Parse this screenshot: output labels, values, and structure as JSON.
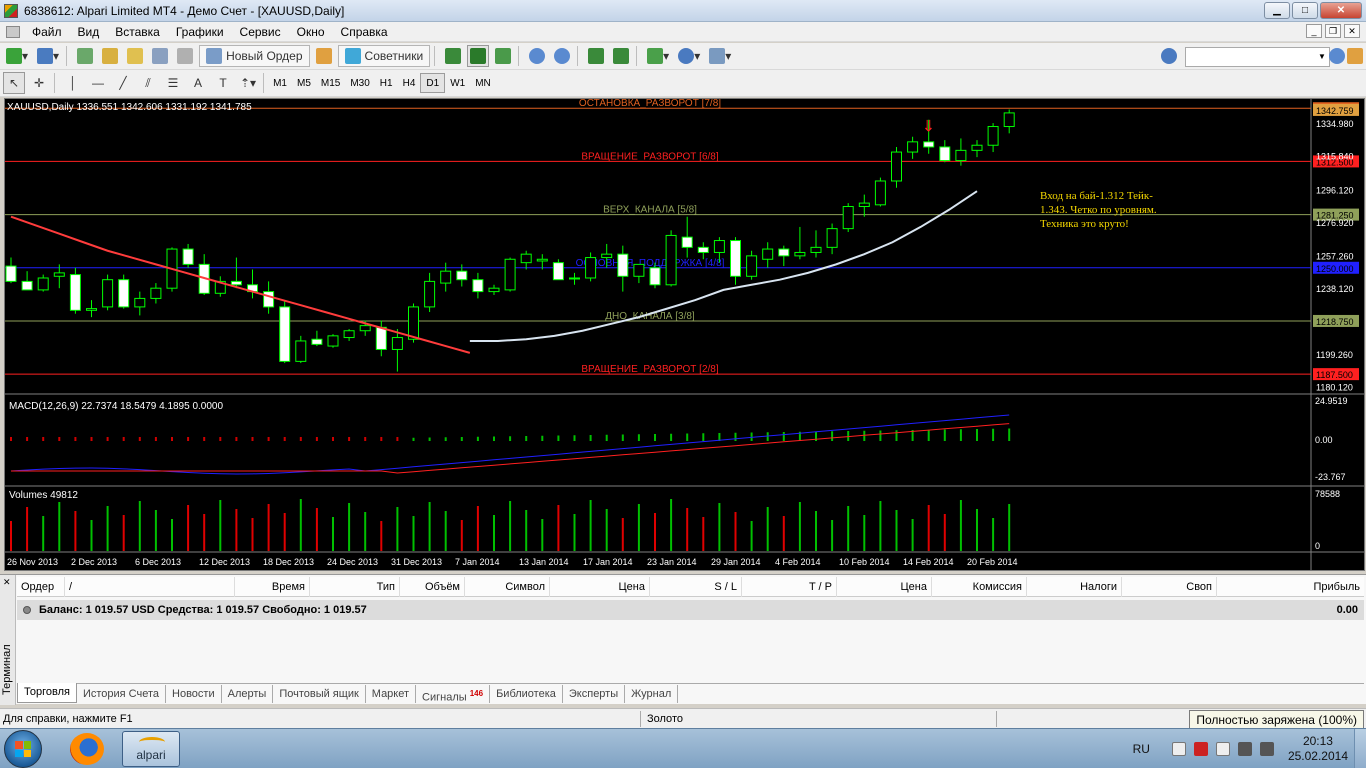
{
  "window": {
    "title": "6838612: Alpari Limited MT4 - Демо Счет - [XAUUSD,Daily]",
    "min": "▁",
    "max": "□",
    "close": "✕"
  },
  "menu": [
    "Файл",
    "Вид",
    "Вставка",
    "Графики",
    "Сервис",
    "Окно",
    "Справка"
  ],
  "toolbar": {
    "new_order": "Новый Ордер",
    "experts": "Советники",
    "timeframes": [
      "M1",
      "M5",
      "M15",
      "M30",
      "H1",
      "H4",
      "D1",
      "W1",
      "MN"
    ],
    "selected_timeframe": "D1"
  },
  "chart": {
    "header": "XAUUSD,Daily  1336.551 1342.606 1331.192 1341.785",
    "macd_label": "MACD(12,26,9) 22.7374 18.5479 4.1895 0.0000",
    "volumes_label": "Volumes 49812",
    "annotation_lines": [
      "Вход на бай-1.312 Тейк-",
      "1.343. Четко по уровням.",
      "Техника это круто!"
    ],
    "colors": {
      "bull": "#00ff00",
      "bull_fill": "#000000",
      "bear_fill": "#ffffff",
      "ma_red": "#ff3c3c",
      "ma_light": "#d8e4f0",
      "macd_main": "#2020ff",
      "macd_signal": "#ff2020"
    }
  },
  "chart_data": {
    "type": "candlestick",
    "symbol": "XAUUSD",
    "timeframe": "Daily",
    "price_axis_ticks": [
      "1342.759",
      "1334.980",
      "1315.840",
      "1312.500",
      "1296.120",
      "1281.250",
      "1276.920",
      "1257.260",
      "1250.000",
      "1238.120",
      "1218.750",
      "1199.260",
      "1187.500",
      "1180.120"
    ],
    "date_ticks": [
      "26 Nov 2013",
      "2 Dec 2013",
      "6 Dec 2013",
      "12 Dec 2013",
      "18 Dec 2013",
      "24 Dec 2013",
      "31 Dec 2013",
      "7 Jan 2014",
      "13 Jan 2014",
      "17 Jan 2014",
      "23 Jan 2014",
      "29 Jan 2014",
      "4 Feb 2014",
      "10 Feb 2014",
      "14 Feb 2014",
      "20 Feb 2014"
    ],
    "levels": [
      {
        "label": "ОСТАНОВКА_РАЗВОРОТ [7/8]",
        "price": 1343.75,
        "price_label": "1343.750",
        "color": "#e06020"
      },
      {
        "label": "ВРАЩЕНИЕ_РАЗВОРОТ [6/8]",
        "price": 1312.5,
        "price_label": "1312.500",
        "color": "#ff2020"
      },
      {
        "label": "ВЕРХ_КАНАЛА [5/8]",
        "price": 1281.25,
        "price_label": "1281.250",
        "color": "#8fa05a"
      },
      {
        "label": "ОСНОВНАЯ_ПОДДЕРЖКА [4/8]",
        "price": 1250.0,
        "price_label": "1250.000",
        "color": "#2020ff"
      },
      {
        "label": "ДНО_КАНАЛА [3/8]",
        "price": 1218.75,
        "price_label": "1218.750",
        "color": "#8fa05a"
      },
      {
        "label": "ВРАЩЕНИЕ_РАЗВОРОТ [2/8]",
        "price": 1187.5,
        "price_label": "1187.500",
        "color": "#ff2020"
      }
    ],
    "current_price": "1342.759",
    "candles": [
      [
        1251,
        1256,
        1241,
        1242
      ],
      [
        1242,
        1248,
        1238,
        1237
      ],
      [
        1237,
        1246,
        1236,
        1244
      ],
      [
        1245,
        1252,
        1238,
        1247
      ],
      [
        1246,
        1250,
        1223,
        1225
      ],
      [
        1225,
        1231,
        1221,
        1226
      ],
      [
        1227,
        1246,
        1225,
        1243
      ],
      [
        1243,
        1246,
        1226,
        1227
      ],
      [
        1227,
        1236,
        1222,
        1232
      ],
      [
        1232,
        1241,
        1229,
        1238
      ],
      [
        1238,
        1262,
        1236,
        1261
      ],
      [
        1261,
        1264,
        1250,
        1252
      ],
      [
        1252,
        1258,
        1234,
        1235
      ],
      [
        1235,
        1245,
        1233,
        1242
      ],
      [
        1242,
        1256,
        1238,
        1240
      ],
      [
        1240,
        1249,
        1232,
        1236
      ],
      [
        1236,
        1242,
        1223,
        1227
      ],
      [
        1227,
        1231,
        1194,
        1195
      ],
      [
        1195,
        1210,
        1194,
        1207
      ],
      [
        1208,
        1213,
        1204,
        1205
      ],
      [
        1204,
        1211,
        1203,
        1210
      ],
      [
        1209,
        1214,
        1207,
        1213
      ],
      [
        1213,
        1219,
        1210,
        1216
      ],
      [
        1215,
        1219,
        1198,
        1202
      ],
      [
        1202,
        1214,
        1189,
        1209
      ],
      [
        1208,
        1229,
        1206,
        1227
      ],
      [
        1227,
        1247,
        1224,
        1242
      ],
      [
        1241,
        1253,
        1236,
        1248
      ],
      [
        1248,
        1252,
        1239,
        1243
      ],
      [
        1243,
        1247,
        1232,
        1236
      ],
      [
        1236,
        1240,
        1234,
        1238
      ],
      [
        1237,
        1256,
        1236,
        1255
      ],
      [
        1253,
        1260,
        1249,
        1258
      ],
      [
        1254,
        1258,
        1249,
        1255
      ],
      [
        1253,
        1255,
        1245,
        1243
      ],
      [
        1244,
        1247,
        1240,
        1244
      ],
      [
        1244,
        1259,
        1242,
        1256
      ],
      [
        1256,
        1264,
        1250,
        1258
      ],
      [
        1258,
        1263,
        1236,
        1245
      ],
      [
        1245,
        1251,
        1241,
        1252
      ],
      [
        1250,
        1253,
        1238,
        1240
      ],
      [
        1240,
        1272,
        1239,
        1269
      ],
      [
        1268,
        1280,
        1256,
        1262
      ],
      [
        1262,
        1265,
        1255,
        1259
      ],
      [
        1259,
        1268,
        1253,
        1266
      ],
      [
        1266,
        1268,
        1240,
        1245
      ],
      [
        1245,
        1260,
        1243,
        1257
      ],
      [
        1255,
        1265,
        1250,
        1261
      ],
      [
        1261,
        1263,
        1251,
        1257
      ],
      [
        1257,
        1274,
        1255,
        1259
      ],
      [
        1259,
        1272,
        1256,
        1262
      ],
      [
        1262,
        1276,
        1258,
        1273
      ],
      [
        1273,
        1288,
        1271,
        1286
      ],
      [
        1286,
        1293,
        1280,
        1288
      ],
      [
        1287,
        1303,
        1286,
        1301
      ],
      [
        1301,
        1321,
        1297,
        1318
      ],
      [
        1318,
        1327,
        1314,
        1324
      ],
      [
        1324,
        1337,
        1317,
        1321
      ],
      [
        1321,
        1325,
        1312,
        1313
      ],
      [
        1313,
        1326,
        1310,
        1319
      ],
      [
        1319,
        1325,
        1315,
        1322
      ],
      [
        1322,
        1335,
        1318,
        1333
      ],
      [
        1333,
        1343,
        1329,
        1341
      ]
    ],
    "ma_red": [
      1280,
      1275,
      1270,
      1265,
      1260,
      1256,
      1252,
      1248,
      1244,
      1240,
      1236,
      1232,
      1228,
      1224,
      1220,
      1216,
      1212,
      1208,
      1204,
      1200
    ],
    "ma_light": [
      1207,
      1207,
      1208,
      1210,
      1213,
      1217,
      1221,
      1226,
      1231,
      1237,
      1240,
      1243,
      1247,
      1252,
      1258,
      1265,
      1274,
      1284,
      1295
    ],
    "macd_axis": [
      "24.9519",
      "0.00",
      "-23.767"
    ],
    "volumes_axis": [
      "78588",
      "0"
    ]
  },
  "terminal": {
    "side_label": "Терминал",
    "columns": [
      "Ордер",
      "/",
      "Время",
      "Тип",
      "Объём",
      "Символ",
      "Цена",
      "S / L",
      "T / P",
      "Цена",
      "Комиссия",
      "Налоги",
      "Своп",
      "Прибыль"
    ],
    "balance": "Баланс: 1 019.57 USD  Средства: 1 019.57  Свободно: 1 019.57",
    "profit": "0.00",
    "tabs": [
      "Торговля",
      "История Счета",
      "Новости",
      "Алерты",
      "Почтовый ящик",
      "Маркет",
      "Сигналы",
      "Библиотека",
      "Эксперты",
      "Журнал"
    ],
    "signals_badge": "146",
    "active_tab": "Торговля"
  },
  "status": {
    "help": "Для справки, нажмите F1",
    "symbol": "Золото",
    "battery": "Полностью заряжена (100%)"
  },
  "taskbar": {
    "alpari_label": "alpari",
    "lang": "RU",
    "time": "20:13",
    "date": "25.02.2014"
  }
}
